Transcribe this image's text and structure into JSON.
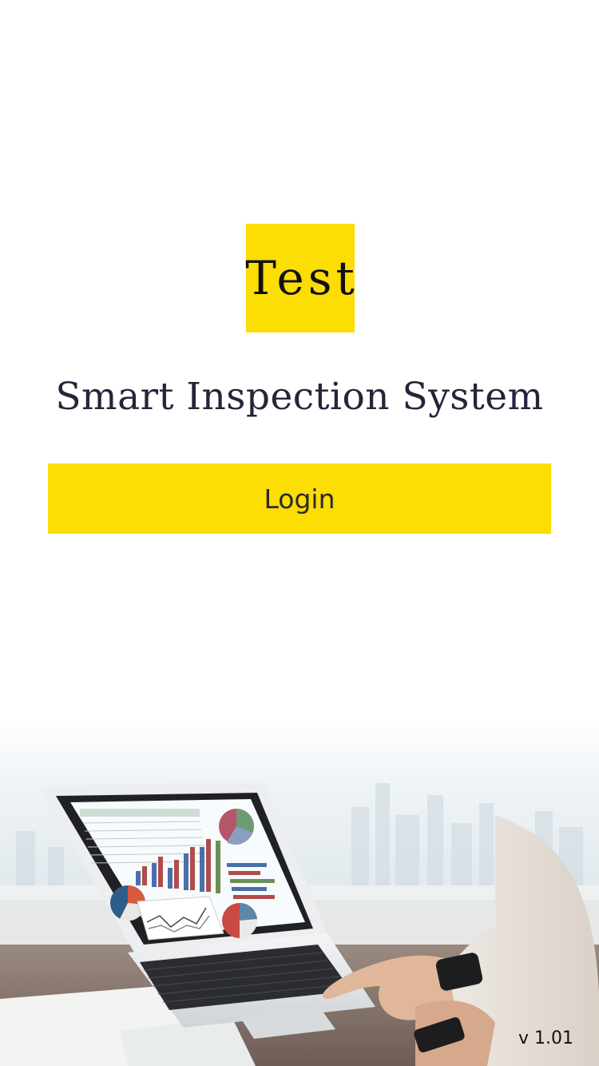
{
  "logo": {
    "text": "Test",
    "background_color": "#fcdd04"
  },
  "app": {
    "title": "Smart Inspection System"
  },
  "login": {
    "label": "Login",
    "color": "#fcdd04"
  },
  "footer": {
    "version": "v 1.01"
  },
  "background": {
    "image": "laptop-analytics-photo"
  }
}
